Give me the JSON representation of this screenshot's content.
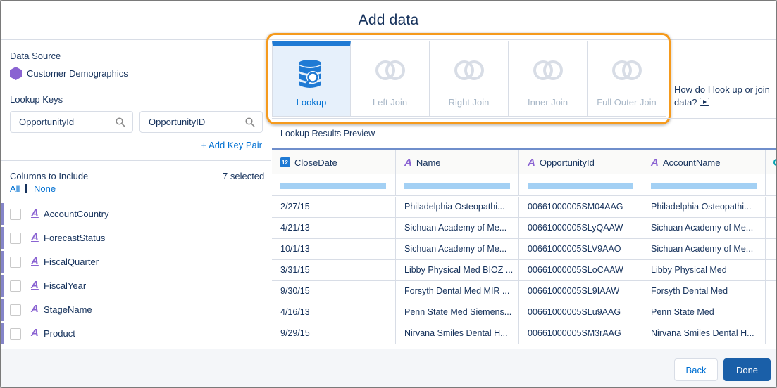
{
  "modal": {
    "title": "Add data"
  },
  "left": {
    "data_source_label": "Data Source",
    "data_source_value": "Customer Demographics",
    "lookup_keys_label": "Lookup Keys",
    "key_left": "OpportunityId",
    "key_right": "OpportunityID",
    "add_key_pair": "+ Add Key Pair",
    "columns_label": "Columns to Include",
    "selected_count": "7 selected",
    "all_link": "All",
    "none_link": "None",
    "columns": [
      {
        "name": "AccountCountry"
      },
      {
        "name": "ForecastStatus"
      },
      {
        "name": "FiscalQuarter"
      },
      {
        "name": "FiscalYear"
      },
      {
        "name": "StageName"
      },
      {
        "name": "Product"
      }
    ]
  },
  "join_types": [
    {
      "label": "Lookup",
      "active": true
    },
    {
      "label": "Left Join",
      "active": false
    },
    {
      "label": "Right Join",
      "active": false
    },
    {
      "label": "Inner Join",
      "active": false
    },
    {
      "label": "Full Outer Join",
      "active": false
    }
  ],
  "help_text": "How do I look up or join data?",
  "preview": {
    "title": "Lookup Results Preview",
    "columns": [
      "CloseDate",
      "Name",
      "OpportunityId",
      "AccountName"
    ],
    "rows": [
      [
        "2/27/15",
        "Philadelphia Osteopathi...",
        "00661000005SM04AAG",
        "Philadelphia Osteopathi..."
      ],
      [
        "4/21/13",
        "Sichuan Academy of Me...",
        "00661000005SLyQAAW",
        "Sichuan Academy of Me..."
      ],
      [
        "10/1/13",
        "Sichuan Academy of Me...",
        "00661000005SLV9AAO",
        "Sichuan Academy of Me..."
      ],
      [
        "3/31/15",
        "Libby Physical Med BIOZ ...",
        "00661000005SLoCAAW",
        "Libby Physical Med"
      ],
      [
        "9/30/15",
        "Forsyth Dental Med MIR ...",
        "00661000005SL9IAAW",
        "Forsyth Dental Med"
      ],
      [
        "4/16/13",
        "Penn State Med Siemens...",
        "00661000005SLu9AAG",
        "Penn State Med"
      ],
      [
        "9/29/15",
        "Nirvana Smiles Dental H...",
        "00661000005SM3rAAG",
        "Nirvana Smiles Dental H..."
      ]
    ]
  },
  "footer": {
    "back_label": "Back",
    "done_label": "Done"
  },
  "colors": {
    "accent": "#0070d2",
    "highlight": "#f59a1d",
    "done": "#1a5fa8"
  }
}
